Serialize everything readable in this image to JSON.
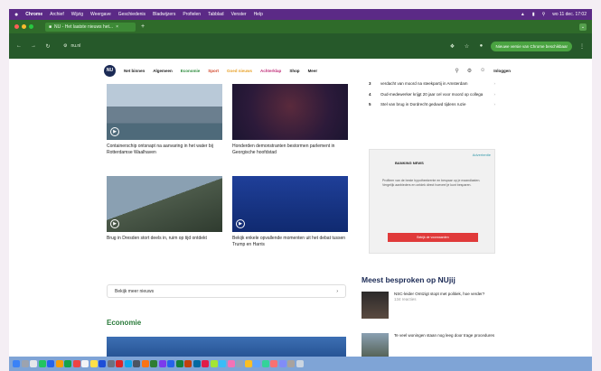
{
  "menubar": {
    "items": [
      "Chrome",
      "Archief",
      "Wijzig",
      "Weergave",
      "Geschiedenis",
      "Bladwijzers",
      "Profielen",
      "Tabblad",
      "Venster",
      "Help"
    ],
    "clock": "wo 11 dec. 17:02"
  },
  "browser": {
    "tab_title": "NU - Het laatste nieuws het...",
    "url": "nu.nl",
    "update_button": "Nieuwe versie van Chrome beschikbaar"
  },
  "site": {
    "logo": "NU",
    "nav": [
      "Net binnen",
      "Algemeen",
      "Economie",
      "Sport",
      "Goed nieuws",
      "Achterklap",
      "Shop"
    ],
    "nav_more": "Meer",
    "login": "Inloggen"
  },
  "articles": [
    {
      "title": "Containerschip ontsnapt na aanvaring in het water bij Rotterdamse Waalhaven"
    },
    {
      "title": "Honderden demonstranten bestormen parlement in Georgische hoofdstad"
    },
    {
      "title": "Brug in Dresden stort deels in, ruim op tijd ontdekt"
    },
    {
      "title": "Bekijk enkele opvallende momenten uit het debat tussen Trump en Harris"
    }
  ],
  "show_more": "Bekijk meer nieuws",
  "economy_section": "Economie",
  "top_list": [
    {
      "num": "3",
      "text": "verdacht van moord na steekpartij in Amsterdam"
    },
    {
      "num": "4",
      "text": "Oud-medewerker krijgt 20 jaar cel voor moord op collega"
    },
    {
      "num": "5",
      "text": "Stel van brug in Dordrecht geduwd tijdens ruzie"
    }
  ],
  "ad": {
    "label": "Advertentie",
    "logo": "BANKING NEWS",
    "text": "Profiteer van de beste hypotheekrente en bespaar op je maandlasten. Vergelijk aanbieders en ontdek direct hoeveel je kunt besparen.",
    "button": "Bekijk de voorwaarden"
  },
  "discussed": {
    "title": "Meest besproken op NUjij",
    "items": [
      {
        "text": "NSC-leider Omtzigt stopt met politiek, hoe verder?",
        "meta": "134 reacties"
      },
      {
        "text": "Te veel woningen staan nog leeg door trage procedures",
        "meta": ""
      }
    ]
  }
}
